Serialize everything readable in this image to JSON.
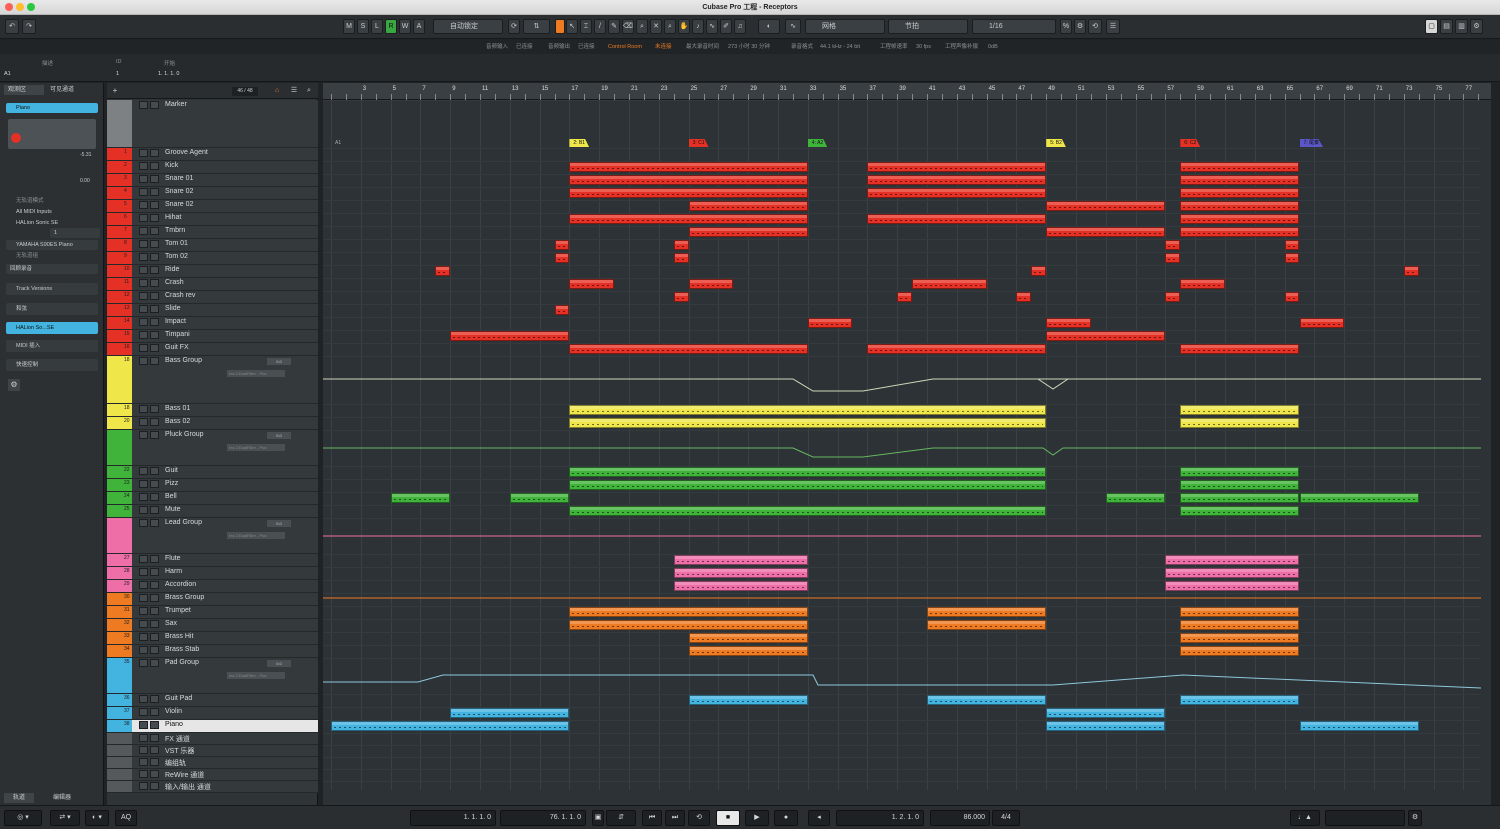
{
  "window": {
    "title": "Cubase Pro 工程 - Receptors"
  },
  "toolbar": {
    "m": "M",
    "s": "S",
    "l": "L",
    "r": "R",
    "w": "W",
    "a": "A",
    "auto_mode": "自动锁定",
    "snap_type": "网格",
    "grid_type": "节拍",
    "quantize": "1/16"
  },
  "infoline": {
    "audio_in": "音频输入",
    "connected1": "已连接",
    "audio_out": "音频输出",
    "connected2": "已连接",
    "control_room": "Control Room",
    "disconnected": "未连接",
    "max_rec": "最大录音时间",
    "rec_time": "273 小时 30 分钟",
    "rec_format": "录音格式",
    "format": "44.1 kHz - 24 bit",
    "frame_rate_lbl": "工程帧速率",
    "frame_rate": "30 fps",
    "pan_lbl": "工程声像补偿",
    "pan": "0dB"
  },
  "infobar": {
    "col_desc": "描述",
    "col_id": "ID",
    "col_start": "开始",
    "desc": "A1",
    "id": "1",
    "start": "1. 1. 1.   0"
  },
  "inspector": {
    "tab_view": "观测区",
    "tab_visible": "可见通道",
    "track_name": "Piano",
    "volume": "-5.31",
    "pan": "0.00",
    "input": "无轨道模式",
    "midi_in": "All MIDI Inputs",
    "output": "HALion Sonic SE",
    "channel": "1",
    "program": "YAMAHA S90ES Piano",
    "no_bank": "无轨道组",
    "record": "回顾录音",
    "section_versions": "Track Versions",
    "section_chords": "和弦",
    "section_instrument": "HALion So...SE",
    "section_midi": "MIDI 插入",
    "section_quick": "快速控制",
    "bottom_tab_tracks": "轨道",
    "bottom_tab_editor": "编辑器"
  },
  "tracklist": {
    "counter": "46 / 48"
  },
  "tracks": [
    {
      "name": "Marker",
      "num": "",
      "color": "#7d8184"
    },
    {
      "name": "Groove Agent",
      "num": "1",
      "color": "#e53125"
    },
    {
      "name": "Kick",
      "num": "2",
      "color": "#e53125"
    },
    {
      "name": "Snare 01",
      "num": "3",
      "color": "#e53125"
    },
    {
      "name": "Snare 02",
      "num": "4",
      "color": "#e53125"
    },
    {
      "name": "Snare 02",
      "num": "5",
      "color": "#e53125"
    },
    {
      "name": "Hihat",
      "num": "6",
      "color": "#e53125"
    },
    {
      "name": "Tmbrn",
      "num": "7",
      "color": "#e53125"
    },
    {
      "name": "Tom 01",
      "num": "8",
      "color": "#e53125"
    },
    {
      "name": "Tom 02",
      "num": "9",
      "color": "#e53125"
    },
    {
      "name": "Ride",
      "num": "10",
      "color": "#e53125"
    },
    {
      "name": "Crash",
      "num": "11",
      "color": "#e53125"
    },
    {
      "name": "Crash rev",
      "num": "12",
      "color": "#e53125"
    },
    {
      "name": "Slide",
      "num": "13",
      "color": "#e53125"
    },
    {
      "name": "Impact",
      "num": "14",
      "color": "#e53125"
    },
    {
      "name": "Timpani",
      "num": "15",
      "color": "#e53125"
    },
    {
      "name": "Guit FX",
      "num": "16",
      "color": "#e53125"
    },
    {
      "name": "Bass Group",
      "num": "18",
      "color": "#efe64a"
    },
    {
      "name": "Bass 01",
      "num": "18",
      "color": "#efe64a"
    },
    {
      "name": "Bass 02",
      "num": "20",
      "color": "#efe64a"
    },
    {
      "name": "Pluck Group",
      "num": "",
      "color": "#3fb33a"
    },
    {
      "name": "Guit",
      "num": "22",
      "color": "#3fb33a"
    },
    {
      "name": "Pizz",
      "num": "23",
      "color": "#3fb33a"
    },
    {
      "name": "Bell",
      "num": "24",
      "color": "#3fb33a"
    },
    {
      "name": "Mute",
      "num": "25",
      "color": "#3fb33a"
    },
    {
      "name": "Lead Group",
      "num": "",
      "color": "#ee6ea8"
    },
    {
      "name": "Flute",
      "num": "27",
      "color": "#ee6ea8"
    },
    {
      "name": "Harm",
      "num": "28",
      "color": "#ee6ea8"
    },
    {
      "name": "Accordion",
      "num": "29",
      "color": "#ee6ea8"
    },
    {
      "name": "Brass Group",
      "num": "30",
      "color": "#ee7a22"
    },
    {
      "name": "Trumpet",
      "num": "31",
      "color": "#ee7a22"
    },
    {
      "name": "Sax",
      "num": "32",
      "color": "#ee7a22"
    },
    {
      "name": "Brass Hit",
      "num": "33",
      "color": "#ee7a22"
    },
    {
      "name": "Brass Stab",
      "num": "34",
      "color": "#ee7a22"
    },
    {
      "name": "Pad Group",
      "num": "35",
      "color": "#43b3e0"
    },
    {
      "name": "Guit Pad",
      "num": "36",
      "color": "#43b3e0"
    },
    {
      "name": "Violin",
      "num": "37",
      "color": "#43b3e0"
    },
    {
      "name": "Piano",
      "num": "38",
      "color": "#43b3e0"
    },
    {
      "name": "FX 通道",
      "num": "",
      "color": "#55595c"
    },
    {
      "name": "VST 乐器",
      "num": "",
      "color": "#55595c"
    },
    {
      "name": "编组轨",
      "num": "",
      "color": "#55595c"
    },
    {
      "name": "ReWire 通道",
      "num": "",
      "color": "#55595c"
    },
    {
      "name": "输入/输出 通道",
      "num": "",
      "color": "#55595c"
    }
  ],
  "marker_sub": [
    "定位",
    "循环",
    "辅助"
  ],
  "group_insert": "Ins.2:DualFilter - Pos",
  "group_volume": "0.0",
  "ruler_ticks": [
    "3",
    "5",
    "7",
    "9",
    "11",
    "13",
    "15",
    "17",
    "19",
    "21",
    "23",
    "25",
    "27",
    "29",
    "31",
    "33",
    "35",
    "37",
    "39",
    "41",
    "43",
    "45",
    "47",
    "49",
    "51",
    "53",
    "55",
    "57",
    "59",
    "61",
    "63",
    "65",
    "67",
    "69",
    "71",
    "73",
    "75",
    "77"
  ],
  "markers": [
    "A1",
    "2: B1",
    "3: C1",
    "4: A2",
    "5: B2",
    "6: C2",
    "7: 尾奏"
  ],
  "transport": {
    "left_locator": "1. 1. 1.   0",
    "right_locator": "76. 1. 1.   0",
    "position": "1. 2. 1.   0",
    "tempo": "86.000",
    "signature": "4/4",
    "aq": "AQ"
  }
}
